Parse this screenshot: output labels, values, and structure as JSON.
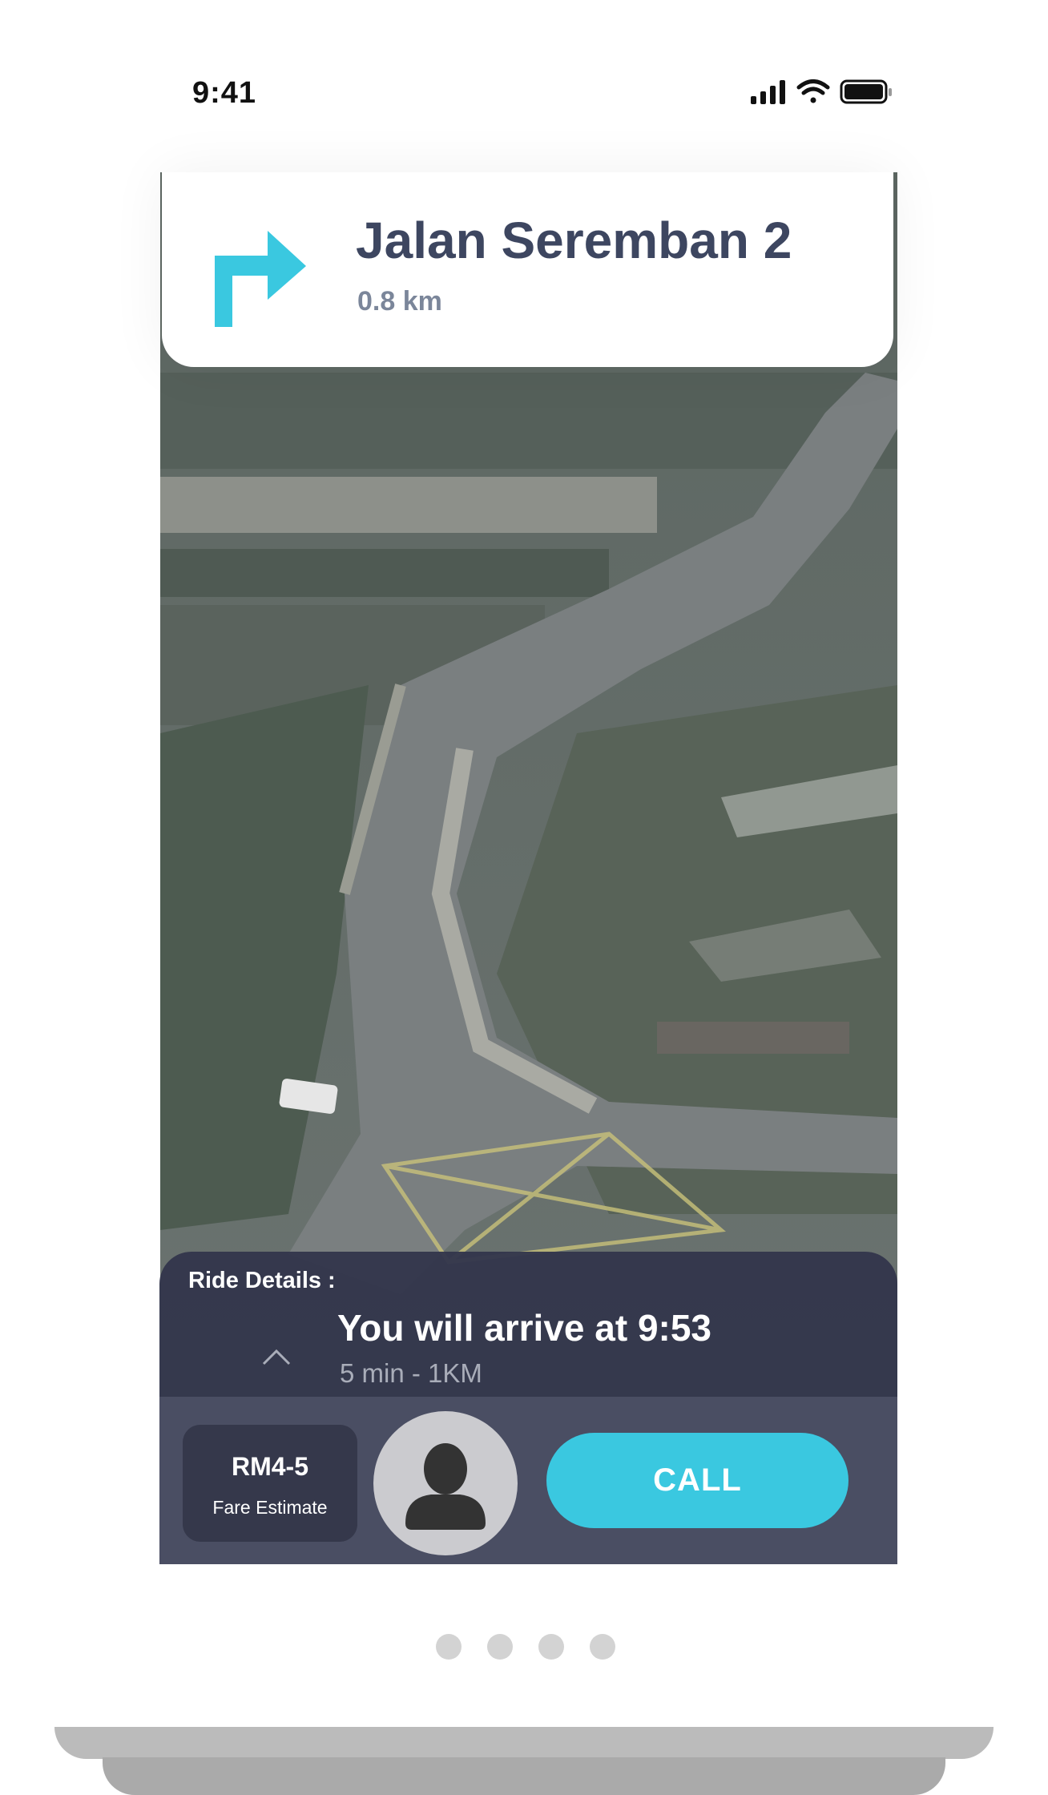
{
  "status_bar": {
    "time": "9:41",
    "icons": [
      "signal-icon",
      "wifi-icon",
      "battery-icon"
    ]
  },
  "navigation": {
    "turn_icon": "turn-right-arrow-icon",
    "street": "Jalan Seremban 2",
    "distance": "0.8 km",
    "accent_color": "#3ac8e0"
  },
  "ride": {
    "section_label": "Ride Details :",
    "arrive_text": "You will arrive at 9:53",
    "eta_detail": "5 min - 1KM",
    "expand_icon": "chevron-up-icon"
  },
  "actions": {
    "fare_value": "RM4-5",
    "fare_label": "Fare Estimate",
    "avatar_icon": "person-avatar-icon",
    "call_label": "CALL"
  },
  "pagination": {
    "count": 4
  }
}
